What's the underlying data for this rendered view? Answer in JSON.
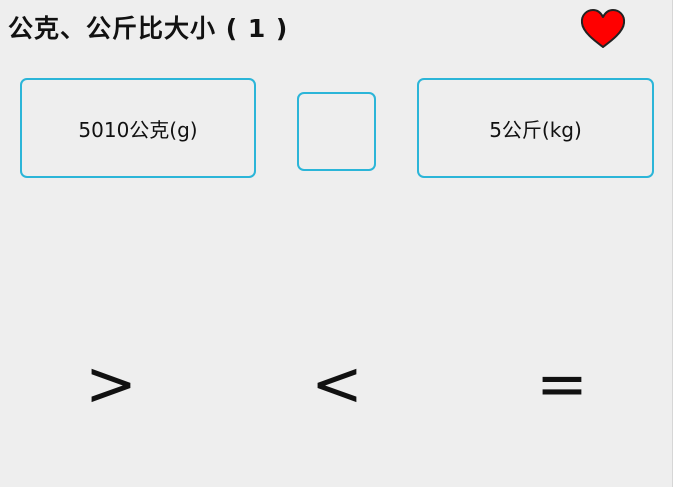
{
  "title": "公克、公斤比大小 ( 1 )",
  "colors": {
    "background": "#eeeeee",
    "box_border": "#2bb5d8",
    "heart_fill": "#ff0000",
    "text": "#111111"
  },
  "icons": {
    "favorite": "heart-icon"
  },
  "question": {
    "left_value": "5010公克(g)",
    "answer_slot": "",
    "right_value": "5公斤(kg)"
  },
  "answers": [
    {
      "symbol": ">"
    },
    {
      "symbol": "<"
    },
    {
      "symbol": "="
    }
  ]
}
